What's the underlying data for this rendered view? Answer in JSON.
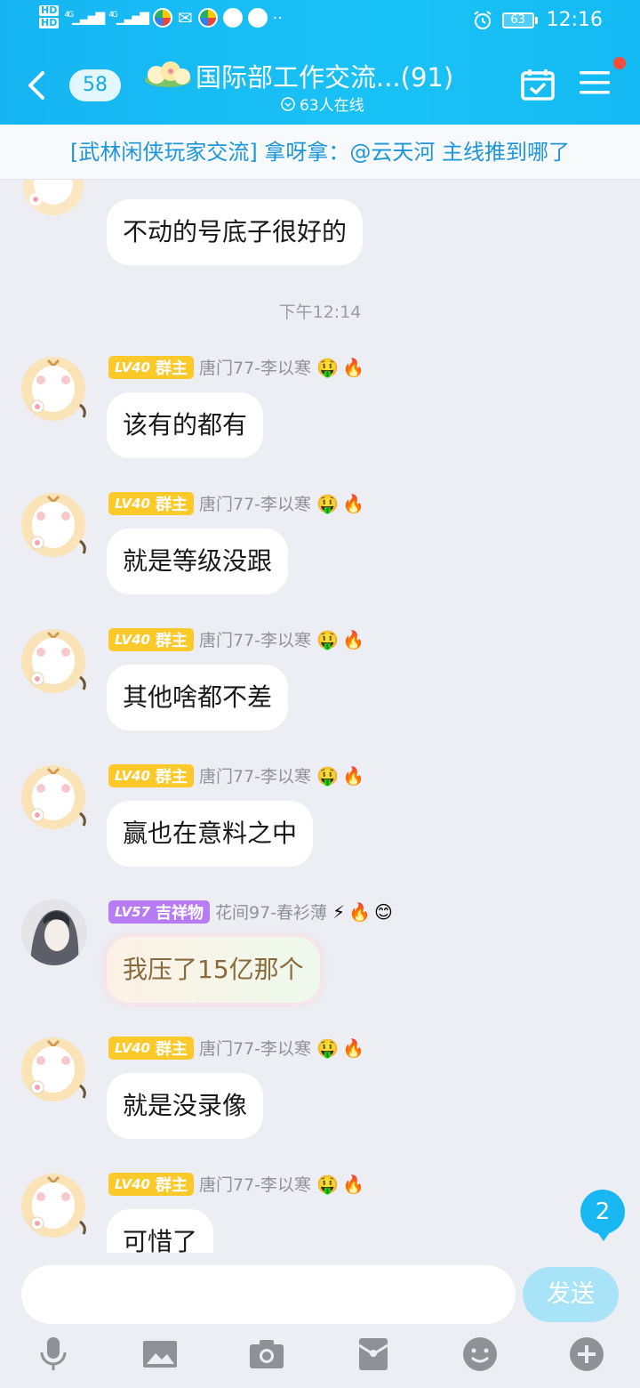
{
  "statusbar": {
    "hd1": "HD",
    "hd2": "HD",
    "net1": "4G",
    "net2": "4G",
    "dots": "··",
    "battery": "63",
    "time": "12:16"
  },
  "header": {
    "unread_count": "58",
    "title": "国际部工作交流...(91)",
    "online": "63人在线"
  },
  "banner": "[武林闲侠玩家交流] 拿呀拿：@云天河 主线推到哪了",
  "messages": [
    {
      "text": "不动的号底子很好的"
    },
    {
      "timestamp": "下午12:14"
    },
    {
      "lv": "LV40",
      "role": "群主",
      "nick": "唐门77-李以寒",
      "text": "该有的都有"
    },
    {
      "lv": "LV40",
      "role": "群主",
      "nick": "唐门77-李以寒",
      "text": "就是等级没跟"
    },
    {
      "lv": "LV40",
      "role": "群主",
      "nick": "唐门77-李以寒",
      "text": "其他啥都不差"
    },
    {
      "lv": "LV40",
      "role": "群主",
      "nick": "唐门77-李以寒",
      "text": "赢也在意料之中"
    },
    {
      "lv": "LV57",
      "role": "吉祥物",
      "nick": "花间97-春衫薄",
      "text": "我压了15亿那个"
    },
    {
      "lv": "LV40",
      "role": "群主",
      "nick": "唐门77-李以寒",
      "text": "就是没录像"
    },
    {
      "lv": "LV40",
      "role": "群主",
      "nick": "唐门77-李以寒",
      "text": "可惜了"
    }
  ],
  "new_message_count": "2",
  "input": {
    "placeholder": "",
    "send_label": "发送"
  },
  "colors": {
    "header": "#16b5f2",
    "owner_badge": "#fcc92b",
    "mascot_badge": "#b77cf3",
    "send_button": "#a9e3f8"
  },
  "icons": [
    "back-icon",
    "calendar-check-icon",
    "menu-icon",
    "microphone-icon",
    "image-icon",
    "camera-icon",
    "red-packet-icon",
    "emoji-icon",
    "plus-icon"
  ]
}
